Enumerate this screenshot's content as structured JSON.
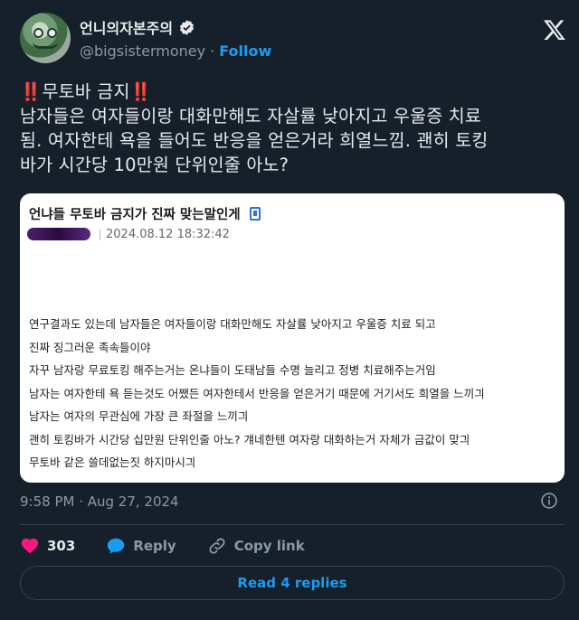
{
  "author": {
    "display_name": "언니의자본주의",
    "handle": "@bigsistermoney",
    "separator": "·",
    "follow_label": "Follow"
  },
  "tweet": {
    "lines": [
      "무토바 금지",
      "남자들은 여자들이랑 대화만해도 자살률 낮아지고 우울증 치료",
      "됨. 여자한테 욕을 들어도 반응을 얻은거라 희열느낌. 괜히 토킹",
      "바가 시간당 10만원 단위인줄 아노?"
    ],
    "emoji": "‼️"
  },
  "quote": {
    "title": "언냐들 무토바 금지가 진짜 맞는말인게",
    "date": "2024.08.12 18:32:42",
    "body": [
      "연구결과도 있는데 남자들은 여자들이랑 대화만해도 자살률 낮아지고 우울증 치료 되고",
      "진짜 징그러운 족속들이야",
      "자꾸 남자랑 무료토킹 해주는거는 온냐들이 도태남들 수명 늘리고 정병 치료해주는거임",
      "남자는 여자한테 욕 듣는것도 어쨌든 여자한테서 반응을 얻은거기 때문에 거기서도 희열을 느끼긔",
      "남자는 여자의 무관심에 가장 큰 좌절을 느끼긔",
      "괜히 토킹바가 시간당 십만원 단위인줄 아노? 걔네한텐 여자랑 대화하는거 자체가 금값이 맞긔",
      "무토바 같은 쓸데없는짓 하지마시긔"
    ]
  },
  "timestamp": "9:58 PM · Aug 27, 2024",
  "actions": {
    "like_count": "303",
    "reply_label": "Reply",
    "copy_label": "Copy link"
  },
  "replies_button": "Read 4 replies",
  "colors": {
    "background": "#15202b",
    "accent": "#1d9bf0",
    "like": "#f91880",
    "reply_icon": "#1d9bf0"
  },
  "icons": [
    "verified-badge-icon",
    "x-logo-icon",
    "phone-icon",
    "info-icon",
    "heart-icon",
    "reply-bubble-icon",
    "link-icon"
  ]
}
